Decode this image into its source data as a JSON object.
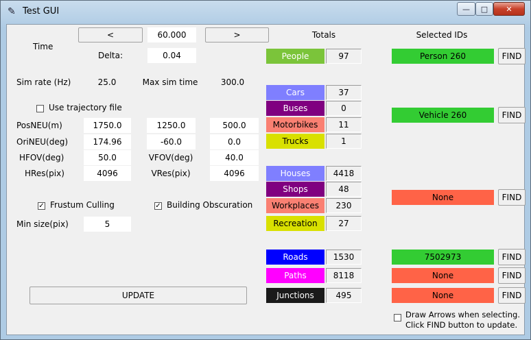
{
  "window": {
    "title": "Test GUI",
    "minimize_glyph": "—",
    "maximize_glyph": "□",
    "close_glyph": "✕",
    "app_icon": "✎"
  },
  "time": {
    "label": "Time",
    "prev_label": "<",
    "value": "60.000",
    "next_label": ">",
    "delta_label": "Delta:",
    "delta_value": "0.04"
  },
  "sim": {
    "rate_label": "Sim rate (Hz)",
    "rate_value": "25.0",
    "max_label": "Max sim time",
    "max_value": "300.0"
  },
  "trajectory": {
    "label": "Use trajectory file",
    "checked": false
  },
  "camera": {
    "pos_label": "PosNEU(m)",
    "pos_n": "1750.0",
    "pos_e": "1250.0",
    "pos_u": "500.0",
    "ori_label": "OriNEU(deg)",
    "ori_n": "174.96",
    "ori_e": "-60.0",
    "ori_u": "0.0",
    "hfov_label": "HFOV(deg)",
    "hfov_value": "50.0",
    "vfov_label": "VFOV(deg)",
    "vfov_value": "40.0",
    "hres_label": "HRes(pix)",
    "hres_value": "4096",
    "vres_label": "VRes(pix)",
    "vres_value": "4096"
  },
  "options": {
    "frustum_label": "Frustum Culling",
    "frustum_checked": true,
    "obscuration_label": "Building Obscuration",
    "obscuration_checked": true,
    "min_size_label": "Min size(pix)",
    "min_size_value": "5",
    "check_glyph": "✓"
  },
  "update_label": "UPDATE",
  "totals_header": "Totals",
  "selected_header": "Selected IDs",
  "totals": {
    "people": {
      "label": "People",
      "count": "97",
      "color": "#7bc43a",
      "text_color": "#ffffff"
    },
    "cars": {
      "label": "Cars",
      "count": "37",
      "color": "#7f7fff",
      "text_color": "#ffffff"
    },
    "buses": {
      "label": "Buses",
      "count": "0",
      "color": "#800080",
      "text_color": "#ffffff"
    },
    "motorbikes": {
      "label": "Motorbikes",
      "count": "11",
      "color": "#fa8072",
      "text_color": "#000000"
    },
    "trucks": {
      "label": "Trucks",
      "count": "1",
      "color": "#d9e000",
      "text_color": "#000000"
    },
    "houses": {
      "label": "Houses",
      "count": "4418",
      "color": "#7f7fff",
      "text_color": "#ffffff"
    },
    "shops": {
      "label": "Shops",
      "count": "48",
      "color": "#800080",
      "text_color": "#ffffff"
    },
    "workplaces": {
      "label": "Workplaces",
      "count": "230",
      "color": "#fa8072",
      "text_color": "#000000"
    },
    "recreation": {
      "label": "Recreation",
      "count": "27",
      "color": "#d9e000",
      "text_color": "#000000"
    },
    "roads": {
      "label": "Roads",
      "count": "1530",
      "color": "#0000ff",
      "text_color": "#ffffff"
    },
    "paths": {
      "label": "Paths",
      "count": "8118",
      "color": "#ff00ff",
      "text_color": "#ffffff"
    },
    "junctions": {
      "label": "Junctions",
      "count": "495",
      "color": "#1a1a1a",
      "text_color": "#ffffff"
    }
  },
  "selected": {
    "person": {
      "value": "Person 260",
      "color": "#33cc33"
    },
    "vehicle": {
      "value": "Vehicle 260",
      "color": "#33cc33"
    },
    "building": {
      "value": "None",
      "color": "#ff6347"
    },
    "road": {
      "value": "7502973",
      "color": "#33cc33"
    },
    "path": {
      "value": "None",
      "color": "#ff6347"
    },
    "junction": {
      "value": "None",
      "color": "#ff6347"
    }
  },
  "find_label": "FIND",
  "arrows": {
    "label_line1": "Draw Arrows when selecting.",
    "label_line2": "Click FIND button to update.",
    "checked": false
  }
}
